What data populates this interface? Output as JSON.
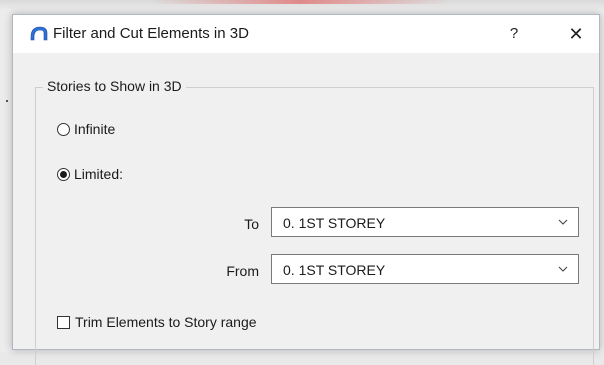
{
  "window": {
    "title": "Filter and Cut Elements in 3D",
    "help_label": "?",
    "close_label": "✕",
    "icon": "archicad-arc-icon"
  },
  "stories_group": {
    "label": "Stories to Show in 3D",
    "options": [
      {
        "label": "Infinite",
        "checked": false
      },
      {
        "label": "Limited:",
        "checked": true
      }
    ],
    "to": {
      "label": "To",
      "value": "0. 1ST STOREY"
    },
    "from": {
      "label": "From",
      "value": "0. 1ST STOREY"
    },
    "trim": {
      "label": "Trim Elements to Story range",
      "checked": false
    }
  },
  "colors": {
    "accent_icon": "#2f6fd6",
    "border": "#7a7a7a"
  }
}
